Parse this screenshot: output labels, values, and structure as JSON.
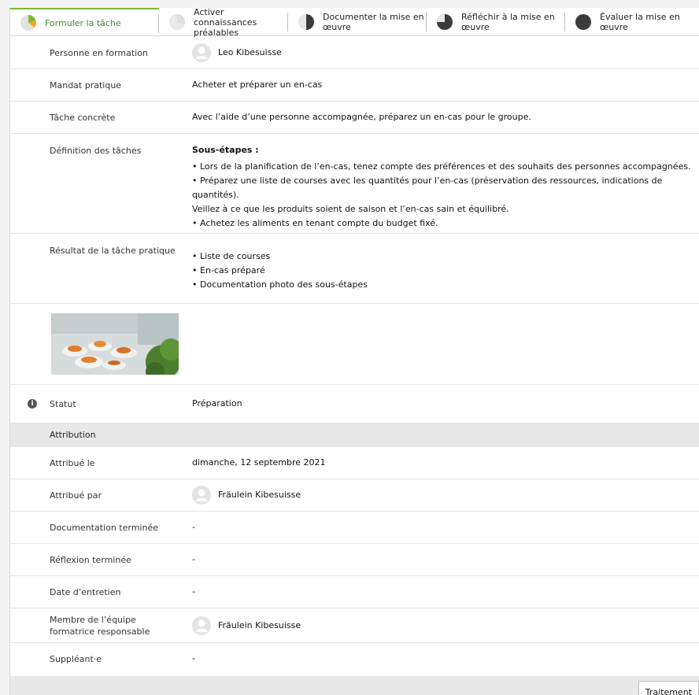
{
  "tabs": [
    {
      "label": "Formuler la tâche",
      "active": true,
      "progress": 0.2
    },
    {
      "label": "Activer connaissances préalables",
      "active": false,
      "progress": 0.4
    },
    {
      "label": "Documenter la mise en œuvre",
      "active": false,
      "progress": 0.6
    },
    {
      "label": "Réfléchir à la mise en œuvre",
      "active": false,
      "progress": 0.8
    },
    {
      "label": "Évaluer la mise en œuvre",
      "active": false,
      "progress": 1.0
    }
  ],
  "fields": {
    "learner": {
      "label": "Personne en formation",
      "value": "Leo Kibesuisse"
    },
    "mandate": {
      "label": "Mandat pratique",
      "value": "Acheter et préparer un en-cas"
    },
    "task": {
      "label": "Tâche concrète",
      "value": "Avec l’aide d’une personne accompagnée, préparez un en-cas pour le groupe."
    },
    "definition": {
      "label": "Définition des tâches",
      "heading": "Sous-étapes :",
      "line1": "• Lors de la planification de l’en-cas, tenez compte des préférences et des souhaits des personnes accompagnées.",
      "line2": "• Préparez une liste de courses avec les quantités pour l’en-cas (préservation des ressources, indications de quantités).",
      "line3": "Veillez à ce que les produits soient de saison et l’en-cas sain et équilibré.",
      "line4": "• Achetez les aliments en tenant compte du budget fixé."
    },
    "result": {
      "label": "Résultat de la tâche pratique",
      "items": [
        "Liste de courses",
        "En-cas préparé",
        "Documentation photo des sous-étapes"
      ]
    },
    "status": {
      "label": "Statut",
      "value": "Préparation"
    }
  },
  "attribution": {
    "section_label": "Attribution",
    "assigned_on": {
      "label": "Attribué le",
      "value": "dimanche, 12 septembre 2021"
    },
    "assigned_by": {
      "label": "Attribué par",
      "value": "Fräulein Kibesuisse"
    },
    "doc_done": {
      "label": "Documentation terminée",
      "value": "-"
    },
    "reflection_done": {
      "label": "Réflexion terminée",
      "value": "-"
    },
    "interview_date": {
      "label": "Date d’entretien",
      "value": "-"
    },
    "trainer": {
      "label": "Membre de l’équipe formatrice responsable",
      "value": "Fräulein Kibesuisse"
    },
    "deputy": {
      "label": "Suppléant·e",
      "value": "-"
    }
  },
  "footer": {
    "action_label": "Traitement"
  },
  "colors": {
    "accent": "#7ab833",
    "accent_text": "#3e8e2e",
    "section_bg": "#e8e8e8"
  },
  "icons": {
    "info": "info-icon",
    "avatar": "user-avatar-icon",
    "progress": "progress-pie-icon"
  }
}
